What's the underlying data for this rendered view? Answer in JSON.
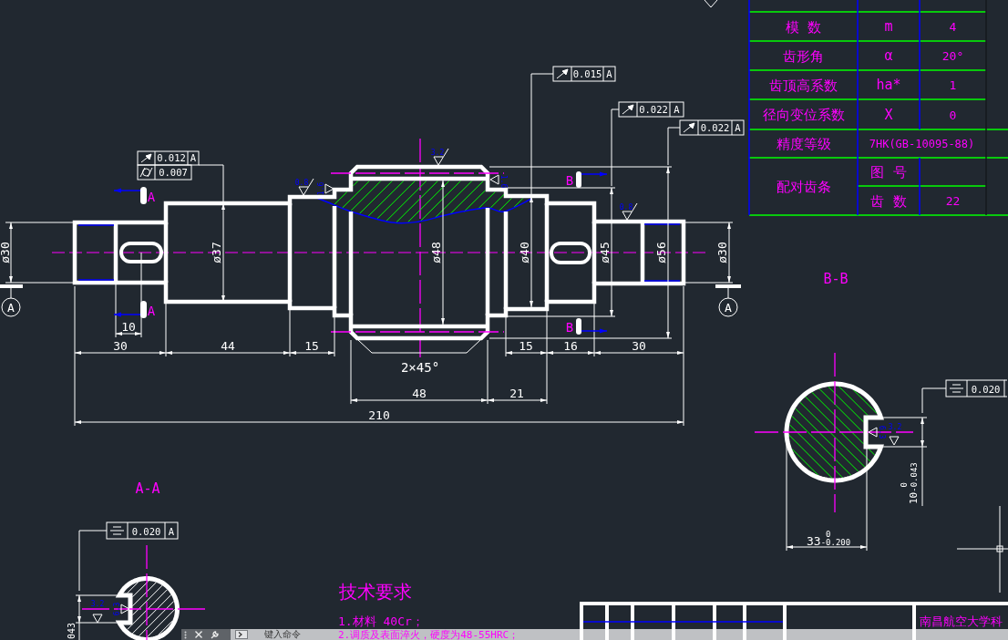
{
  "shaft_view": {
    "tolerance_frames": [
      {
        "kind": "runout",
        "value": "0.012",
        "datum": "A"
      },
      {
        "kind": "cylindricity",
        "value": "0.007"
      },
      {
        "kind": "runout",
        "value": "0.015",
        "datum": "A"
      },
      {
        "kind": "runout",
        "value": "0.022",
        "datum": "A"
      },
      {
        "kind": "runout",
        "value": "0.022",
        "datum": "A"
      }
    ],
    "section_marks": [
      {
        "letter": "A"
      },
      {
        "letter": "A"
      },
      {
        "letter": "B"
      },
      {
        "letter": "B"
      }
    ],
    "datum_marks": [
      {
        "letter": "A"
      },
      {
        "letter": "A"
      }
    ],
    "diameters": [
      "ø30",
      "ø37",
      "ø48",
      "ø40",
      "ø45",
      "ø56",
      "ø30"
    ],
    "lengths": [
      "10",
      "30",
      "44",
      "15",
      "15",
      "16",
      "30",
      "48",
      "21",
      "210"
    ],
    "chamfer": "2×45°",
    "roughness": [
      "0.8",
      "1.6",
      "3.2",
      "1.6",
      "0.8"
    ]
  },
  "gear_table": {
    "rows": [
      {
        "name": "模 数",
        "symbol": "m",
        "value": "4"
      },
      {
        "name": "齿形角",
        "symbol": "α",
        "value": "20°"
      },
      {
        "name": "齿顶高系数",
        "symbol": "ha*",
        "value": "1"
      },
      {
        "name": "径向变位系数",
        "symbol": "X",
        "value": "0"
      }
    ],
    "accuracy": {
      "name": "精度等级",
      "value": "7HK(GB-10095-88)"
    },
    "mating_rack": {
      "name": "配对齿条",
      "rows": [
        {
          "label": "图 号"
        },
        {
          "label": "齿 数",
          "value": "22"
        }
      ]
    }
  },
  "section_b": {
    "title": "B-B",
    "tolerance_frame": {
      "kind": "symmetry",
      "value": "0.020"
    },
    "width": {
      "nominal": "33",
      "upper": "0",
      "lower": "-0.200"
    },
    "keyway": {
      "nominal": "10",
      "upper": "0",
      "lower": "-0.043"
    },
    "roughness": [
      "6.3",
      "3.2"
    ]
  },
  "section_a": {
    "title": "A-A",
    "tolerance_frame": {
      "kind": "symmetry",
      "value": "0.020",
      "datum": "A"
    },
    "keyway_dimension": "043",
    "roughness": [
      "3.2",
      "6.3"
    ]
  },
  "requirements": {
    "title": "技术要求",
    "items": [
      "1.材料 40Cr；",
      "2.调质及表面淬火，硬度为48-55HRC；"
    ]
  },
  "title_block": {
    "school": "南昌航空大学科"
  },
  "command_line": {
    "placeholder": "键入命令"
  }
}
